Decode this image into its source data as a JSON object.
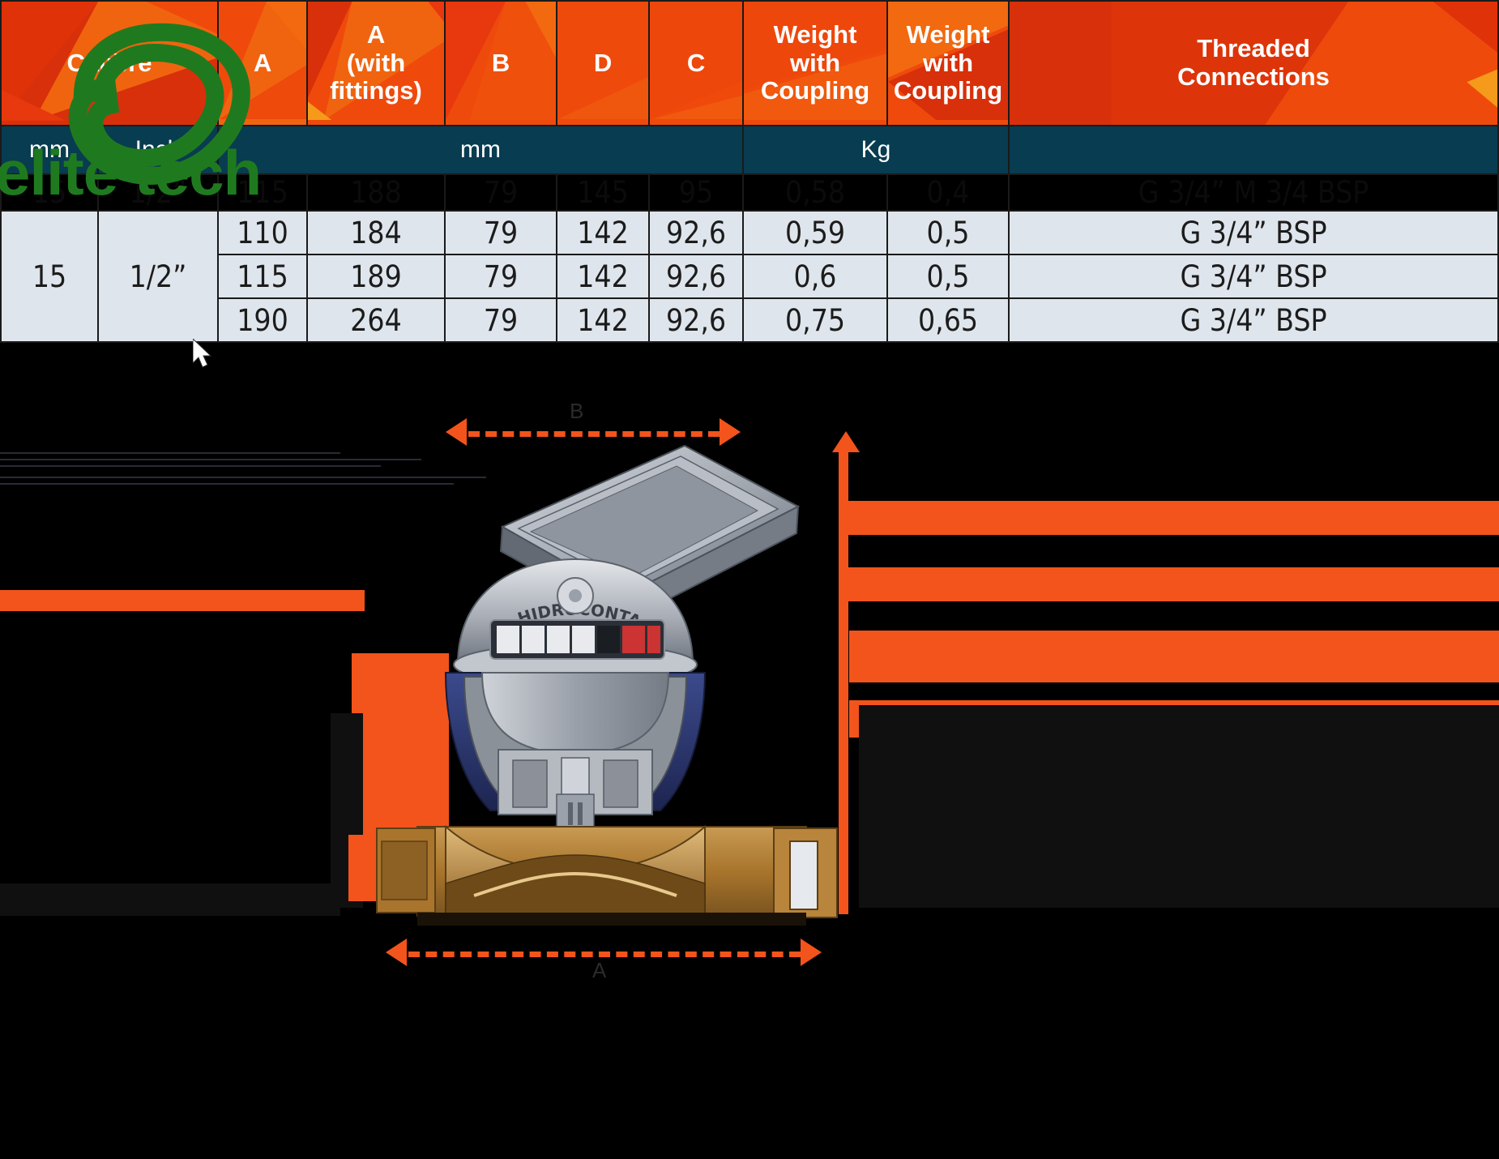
{
  "table": {
    "header_top": [
      {
        "key": "calibre",
        "label": "Calibre",
        "colspan": 2
      },
      {
        "key": "a",
        "label": "A",
        "colspan": 1
      },
      {
        "key": "a_fittings",
        "label": "A\n(with fittings)",
        "colspan": 1
      },
      {
        "key": "b",
        "label": "B",
        "colspan": 1
      },
      {
        "key": "d",
        "label": "D",
        "colspan": 1
      },
      {
        "key": "c",
        "label": "C",
        "colspan": 1
      },
      {
        "key": "weight_with_coupling_1",
        "label": "Weight with Coupling",
        "colspan": 1
      },
      {
        "key": "weight_with_coupling_2",
        "label": "Weight with Coupling",
        "colspan": 1
      },
      {
        "key": "threaded_connections",
        "label": "Threaded Connections",
        "colspan": 1
      }
    ],
    "header_top_labels": {
      "calibre": "Calibre",
      "a": "A",
      "a_fittings_line1": "A",
      "a_fittings_line2": "(with",
      "a_fittings_line3": "fittings)",
      "b": "B",
      "d": "D",
      "c": "C",
      "weight_line1": "Weight",
      "weight_line2": "with",
      "weight_line3": "Coupling",
      "threaded_line1": "Threaded",
      "threaded_line2": "Connections"
    },
    "header_units": [
      {
        "key": "mm",
        "label": "mm",
        "colspan": 1
      },
      {
        "key": "inch",
        "label": "Inch",
        "colspan": 1
      },
      {
        "key": "mm_group",
        "label": "mm",
        "colspan": 5
      },
      {
        "key": "kg_group",
        "label": "Kg",
        "colspan": 2
      },
      {
        "key": "blank",
        "label": "",
        "colspan": 1
      }
    ],
    "clipped_row_top": {
      "calibre_mm": "15",
      "calibre_inch": "1/2”",
      "a": "115",
      "a_fittings": "188",
      "b": "79",
      "d": "145",
      "c": "95",
      "weight_1": "0,58",
      "weight_2": "0,4",
      "threaded": "G 3/4” M 3/4 BSP"
    },
    "rows": [
      {
        "a": "110",
        "a_fittings": "184",
        "b": "79",
        "d": "142",
        "c": "92,6",
        "weight_1": "0,59",
        "weight_2": "0,5",
        "threaded": "G 3/4” BSP"
      },
      {
        "a": "115",
        "a_fittings": "189",
        "b": "79",
        "d": "142",
        "c": "92,6",
        "weight_1": "0,6",
        "weight_2": "0,5",
        "threaded": "G 3/4” BSP"
      },
      {
        "a": "190",
        "a_fittings": "264",
        "b": "79",
        "d": "142",
        "c": "92,6",
        "weight_1": "0,75",
        "weight_2": "0,65",
        "threaded": "G 3/4” BSP"
      }
    ],
    "calibre_group": {
      "mm": "15",
      "inch": "1/2”"
    }
  },
  "diagram": {
    "dim_b_label": "B",
    "dim_a_label": "A",
    "meter_brand": "HIDROCONTA",
    "meter_model": "",
    "counter_digits": ""
  },
  "watermark": {
    "text": "elite tech",
    "color": "#1f7a1f"
  },
  "colors": {
    "header_orange": "#e8380d",
    "header_orange_light": "#f0640f",
    "header_teal": "#083c50",
    "row_bg": "#dfe5ec",
    "accent_orange": "#f2541b",
    "text_dark": "#1c1c1c",
    "black": "#000000"
  }
}
